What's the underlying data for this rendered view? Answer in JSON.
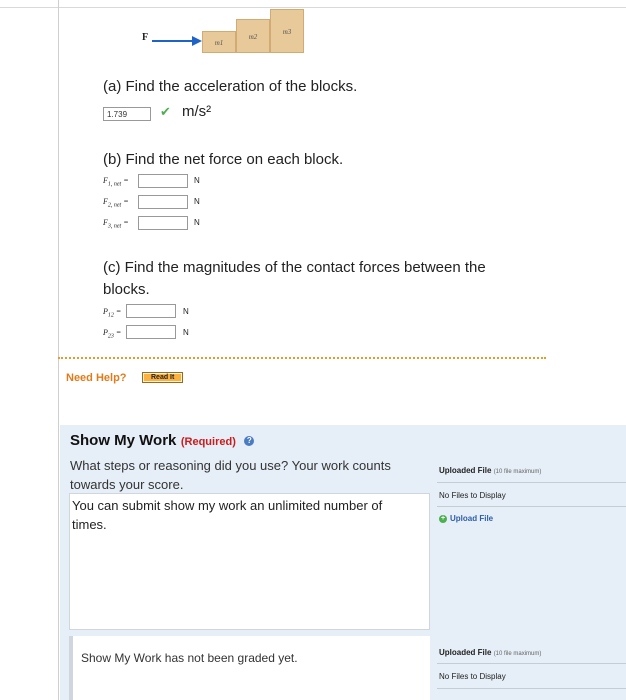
{
  "diagram": {
    "force_label": "F",
    "blocks": [
      "m1",
      "m2",
      "m3"
    ]
  },
  "part_a": {
    "question": "(a) Find the acceleration of the blocks.",
    "answer_value": "1.739",
    "unit": "m/s²"
  },
  "part_b": {
    "question": "(b) Find the net force on each block.",
    "fields": [
      {
        "label": "F",
        "sub": "1, net",
        "suffix": " =",
        "unit": "N"
      },
      {
        "label": "F",
        "sub": "2, net",
        "suffix": " =",
        "unit": "N"
      },
      {
        "label": "F",
        "sub": "3, net",
        "suffix": " =",
        "unit": "N"
      }
    ]
  },
  "part_c": {
    "question_line1": "(c) Find the magnitudes of the contact forces between the",
    "question_line2": "blocks.",
    "fields": [
      {
        "label": "P",
        "sub": "12",
        "suffix": " =",
        "unit": "N"
      },
      {
        "label": "P",
        "sub": "23",
        "suffix": " =",
        "unit": "N"
      }
    ]
  },
  "help": {
    "need_help": "Need Help?",
    "read_it": "Read It"
  },
  "show_my_work": {
    "title": "Show My Work",
    "required": "(Required)",
    "desc_line1": "What steps or reasoning did you use? Your work counts",
    "desc_line2": "towards your score.",
    "textarea_line1": "You can submit show my work an unlimited number of",
    "textarea_line2": "times.",
    "graded_status": "Show My Work has not been graded yet."
  },
  "uploads": {
    "title": "Uploaded File",
    "max_note": "(10 file maximum)",
    "no_files": "No Files to Display",
    "upload_link": "Upload File"
  },
  "colors": {
    "accent_blue": "#1f63c7",
    "need_help_orange": "#e07b1a",
    "required_red": "#cc1b1b",
    "check_green": "#4caf50",
    "panel_bg": "#e6eef7"
  }
}
